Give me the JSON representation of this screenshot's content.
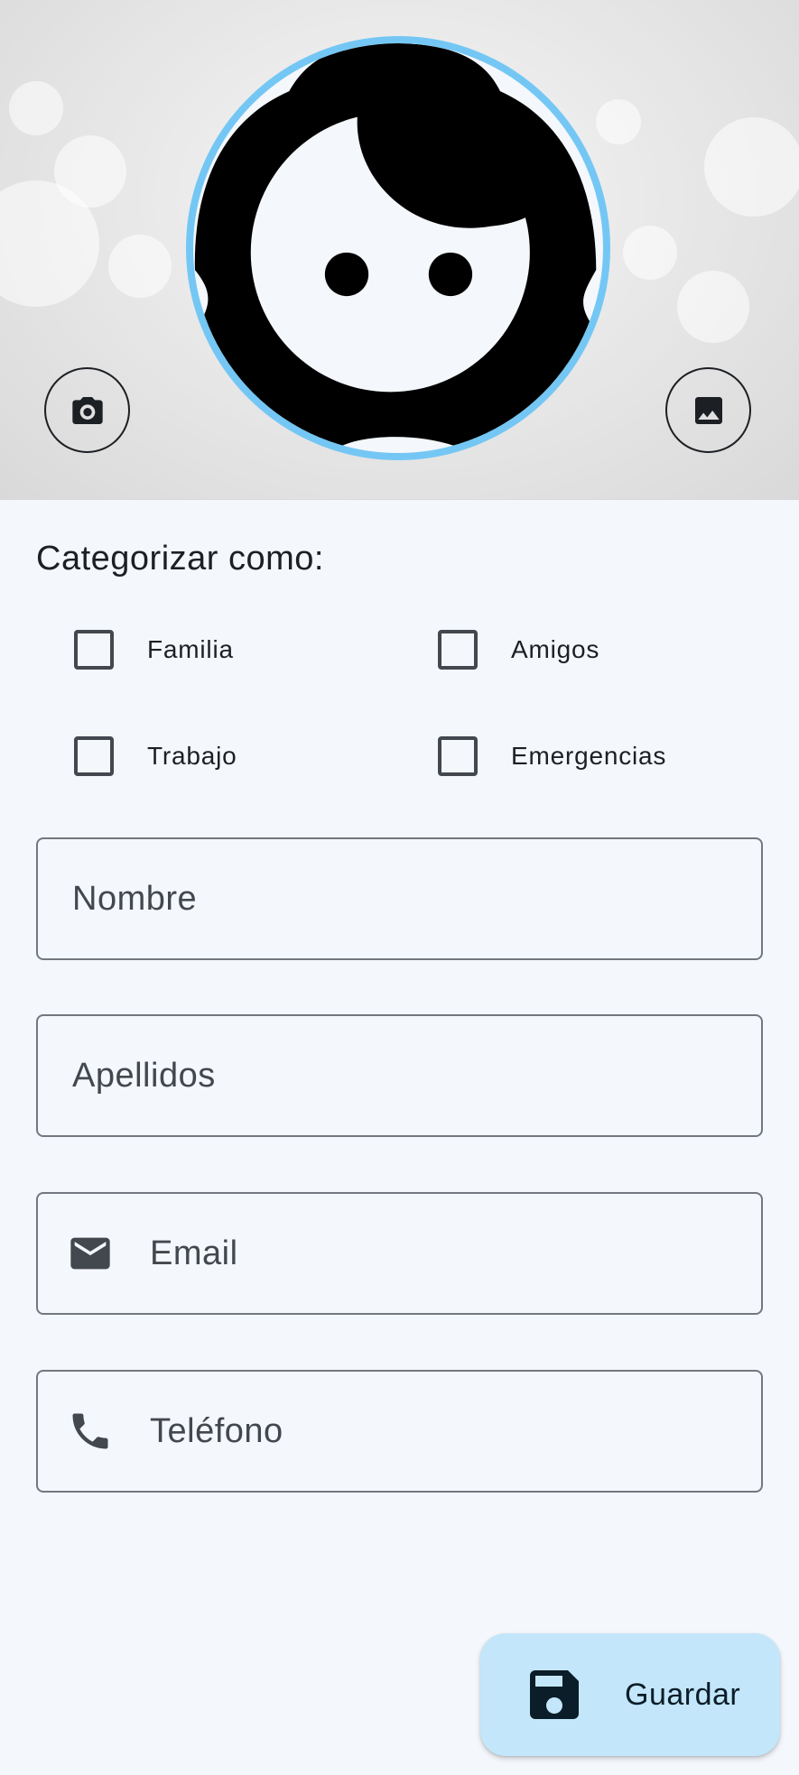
{
  "header": {
    "avatar_icon": "face-icon",
    "camera_button_icon": "camera-icon",
    "gallery_button_icon": "image-icon",
    "avatar_border_color": "#74c7f4"
  },
  "categories": {
    "label": "Categorizar como:",
    "options": [
      {
        "label": "Familia",
        "checked": false
      },
      {
        "label": "Amigos",
        "checked": false
      },
      {
        "label": "Trabajo",
        "checked": false
      },
      {
        "label": "Emergencias",
        "checked": false
      }
    ]
  },
  "form": {
    "nombre_placeholder": "Nombre",
    "apellidos_placeholder": "Apellidos",
    "email_placeholder": "Email",
    "email_icon": "email-icon",
    "telefono_placeholder": "Teléfono",
    "telefono_icon": "phone-icon"
  },
  "fab": {
    "label": "Guardar",
    "icon": "save-icon",
    "background": "#c3e6fa"
  }
}
